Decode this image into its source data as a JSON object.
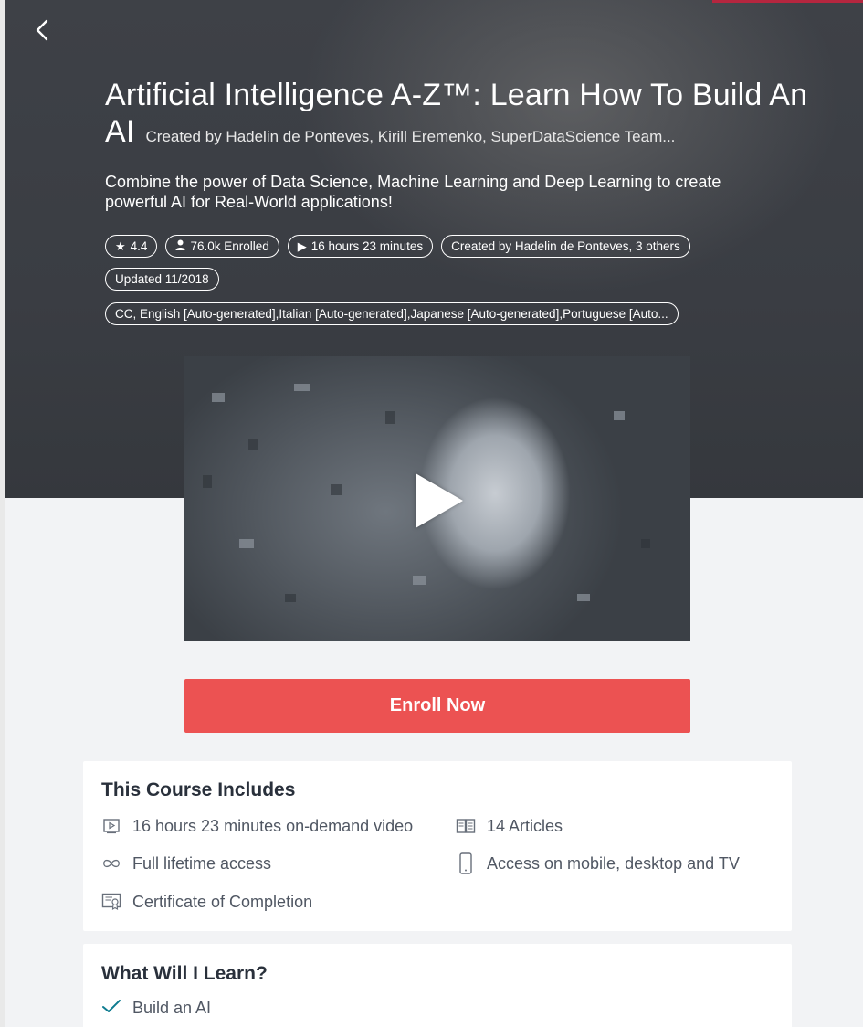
{
  "course": {
    "title": "Artificial Intelligence A-Z™: Learn How To Build An AI",
    "created_by_inline": "Created by Hadelin de Ponteves, Kirill Eremenko, SuperDataScience Team...",
    "subtitle": "Combine the power of Data Science, Machine Learning and Deep Learning to create powerful AI for Real-World applications!"
  },
  "badges": {
    "rating": "4.4",
    "enrolled": "76.0k Enrolled",
    "duration": "16 hours 23 minutes",
    "created_by": "Created by Hadelin de Ponteves, 3 others",
    "updated": "Updated 11/2018",
    "captions": "CC, English [Auto-generated],Italian [Auto-generated],Japanese [Auto-generated],Portuguese [Auto..."
  },
  "icons": {
    "back": "chevron-left-icon",
    "rating": "star-icon",
    "enrolled": "user-icon",
    "duration": "play-icon",
    "video": "video-icon",
    "articles": "article-icon",
    "lifetime": "infinity-icon",
    "mobile": "mobile-icon",
    "certificate": "certificate-icon",
    "check": "check-icon"
  },
  "enroll": {
    "label": "Enroll Now"
  },
  "includes": {
    "heading": "This Course Includes",
    "items": [
      "16 hours 23 minutes on-demand video",
      "14 Articles",
      "Full lifetime access",
      "Access on mobile, desktop and TV",
      "Certificate of Completion"
    ]
  },
  "learn": {
    "heading": "What Will I Learn?",
    "items": [
      "Build an AI"
    ]
  },
  "colors": {
    "hero_bg": "#3c3f45",
    "enroll": "#ec5252",
    "check": "#0f7c90",
    "accent_top": "#b5263f"
  }
}
